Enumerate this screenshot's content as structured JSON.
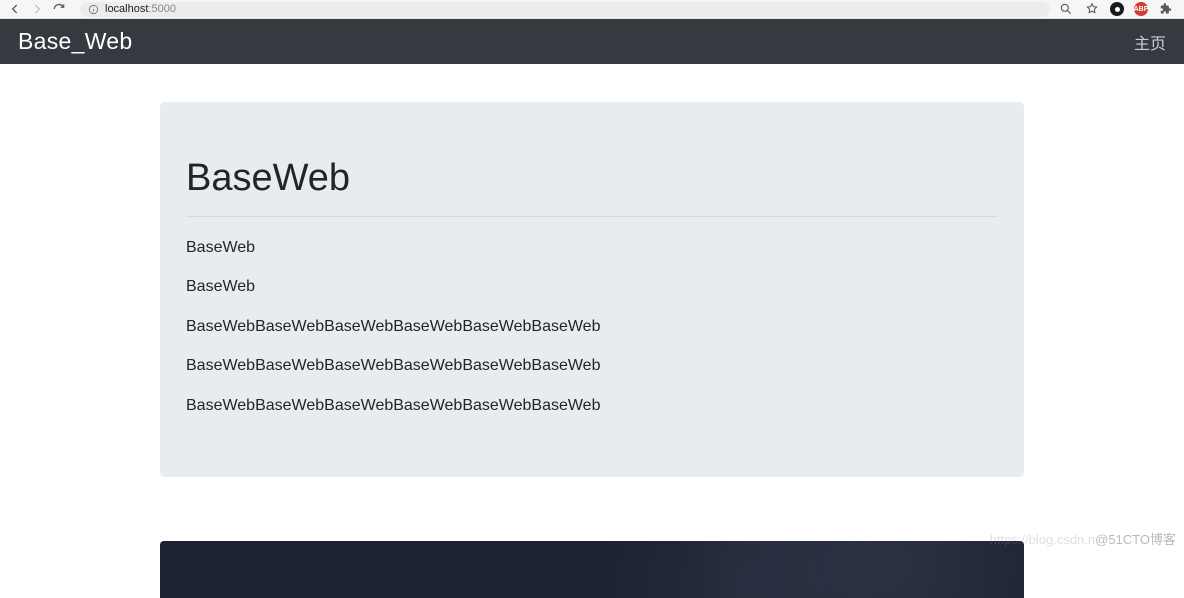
{
  "browser": {
    "url_host": "localhost",
    "url_path": ":5000"
  },
  "navbar": {
    "brand": "Base_Web",
    "home_link": "主页"
  },
  "jumbo": {
    "title": "BaseWeb",
    "paragraphs": [
      "BaseWeb",
      "BaseWeb",
      "BaseWebBaseWebBaseWebBaseWebBaseWebBaseWeb",
      "BaseWebBaseWebBaseWebBaseWebBaseWebBaseWeb",
      "BaseWebBaseWebBaseWebBaseWebBaseWebBaseWeb"
    ]
  },
  "watermark": {
    "faint": "https://blog.csdn.n",
    "text": "@51CTO博客"
  }
}
